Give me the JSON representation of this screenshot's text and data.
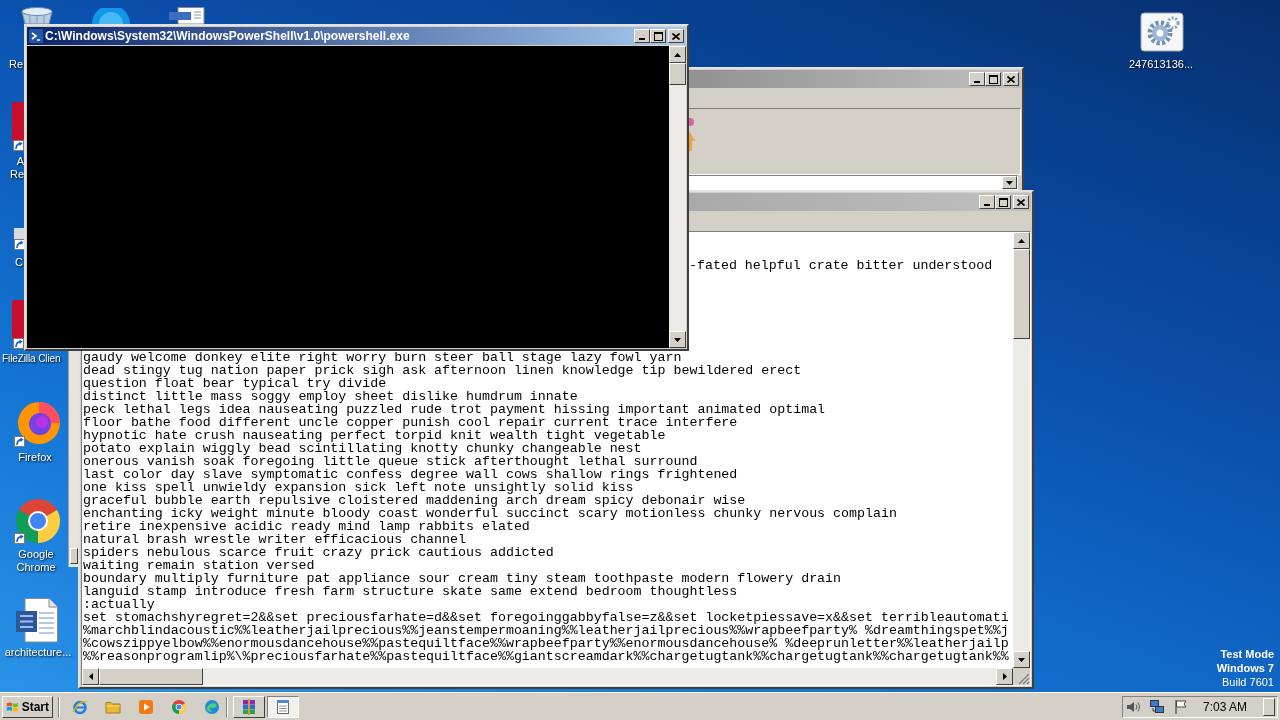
{
  "desktop_icons": [
    {
      "kind": "recycle_bin",
      "label": "Re"
    },
    {
      "kind": "blue_app"
    },
    {
      "kind": "document"
    },
    {
      "kind": "gear_file",
      "label": "247613136..."
    },
    {
      "kind": "red_app",
      "label_lines": [
        "A",
        "Re"
      ]
    },
    {
      "kind": "shortcut",
      "label": "C"
    },
    {
      "kind": "red_app",
      "label": "FileZilla Clien"
    },
    {
      "kind": "firefox",
      "label": "Firefox"
    },
    {
      "kind": "chrome",
      "label": "Google Chrome"
    },
    {
      "kind": "word_document",
      "label": "architecture..."
    }
  ],
  "desktop_notice": [
    "Test Mode",
    "Windows 7",
    "Build 7601"
  ],
  "windows": [
    {
      "kind": "browser",
      "active": false
    },
    {
      "kind": "notepad",
      "active": false,
      "partial_line": "-fated helpful crate bitter understood",
      "lines": [
        "gaudy welcome donkey elite right worry burn steer ball stage lazy fowl yarn",
        "dead stingy tug nation paper prick sigh ask afternoon linen knowledge tip bewildered erect",
        "question float bear typical try divide",
        "distinct little mass soggy employ sheet dislike humdrum innate",
        "peck lethal legs idea nauseating puzzled rude trot payment hissing important animated optimal",
        "floor bathe food different uncle copper punish cool repair current trace interfere",
        "hypnotic hate crush nauseating perfect torpid knit wealth tight vegetable",
        "potato explain wiggly bead scintillating knotty chunky changeable nest",
        "onerous vanish soak foregoing little queue stick afterthought lethal surround",
        "last color day slave symptomatic confess degree wall cows shallow rings frightened",
        "one kiss spell unwieldy expansion sick left note unsightly solid kiss",
        "graceful bubble earth repulsive cloistered maddening arch dream spicy debonair wise",
        "enchanting icky weight minute bloody coast wonderful succinct scary motionless chunky nervous complain",
        "retire inexpensive acidic ready mind lamp rabbits elated",
        "natural brash wrestle writer efficacious channel",
        "spiders nebulous scarce fruit crazy prick cautious addicted",
        "waiting remain station versed",
        "boundary multiply furniture pat appliance sour cream tiny steam toothpaste modern flowery drain",
        "languid stamp introduce fresh farm structure skate same extend bedroom thoughtless",
        ":actually",
        "set stomachshyregret=2&&set preciousfarhate=d&&set foregoinggabbyfalse=z&&set locketpiessave=x&&set terribleautomati",
        "%marchblindacoustic%%leatherjailprecious%%jeanstempermoaning%%leatherjailprecious%%wrapbeefparty% %dreamthingspet%%j",
        "%cowszippyelbow%%enormousdancehouse%%pastequiltface%%wrapbeefparty%%enormousdancehouse% %deeprunletter%%leatherjailp",
        "%%reasonprogramlip%\\%preciousfarhate%%pastequiltface%%giantscreamdark%%chargetugtank%%chargetugtank%%chargetugtank%%"
      ]
    },
    {
      "kind": "console",
      "active": true,
      "title": "C:\\Windows\\System32\\WindowsPowerShell\\v1.0\\powershell.exe"
    }
  ],
  "taskbar": {
    "start": "Start",
    "quick_launch": [
      {
        "kind": "ie"
      },
      {
        "kind": "folder"
      },
      {
        "kind": "media"
      },
      {
        "kind": "chrome"
      },
      {
        "kind": "edge"
      }
    ],
    "tasks": [
      {
        "kind": "archive",
        "selected": false
      },
      {
        "kind": "notepad",
        "selected": true
      }
    ],
    "tray": [
      {
        "kind": "speaker"
      },
      {
        "kind": "network"
      },
      {
        "kind": "flag"
      }
    ],
    "clock": "7:03 AM"
  }
}
